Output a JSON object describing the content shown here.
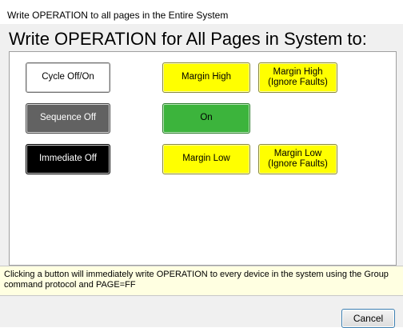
{
  "window": {
    "title": "Write OPERATION to all pages in the Entire System"
  },
  "heading": "Write OPERATION for All Pages in System to:",
  "buttons": {
    "cycle_off_on": "Cycle Off/On",
    "sequence_off": "Sequence Off",
    "immediate_off": "Immediate Off",
    "margin_high": "Margin High",
    "margin_high_ignore": "Margin High\n(Ignore Faults)",
    "on": "On",
    "margin_low": "Margin Low",
    "margin_low_ignore": "Margin Low\n(Ignore Faults)"
  },
  "info_message": "Clicking a button will immediately write OPERATION to every device in the system using the Group command protocol and PAGE=FF",
  "cancel_label": "Cancel",
  "colors": {
    "white_button": "#ffffff",
    "gray_button": "#626262",
    "black_button": "#000000",
    "yellow_button": "#ffff00",
    "green_button": "#3cb43c",
    "info_background": "#ffffe1"
  }
}
